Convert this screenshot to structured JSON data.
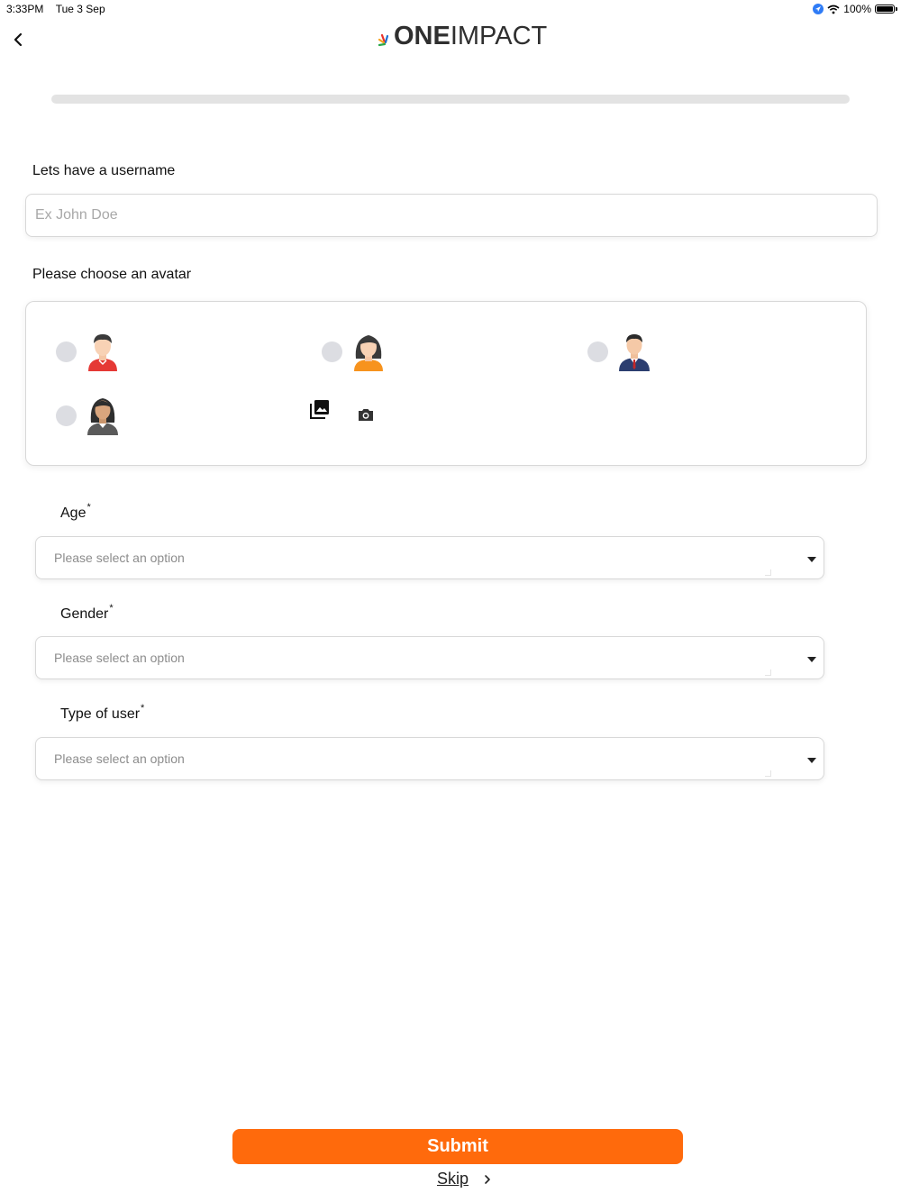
{
  "status_bar": {
    "time": "3:33PM",
    "date": "Tue 3 Sep",
    "battery_percent": "100%",
    "battery_level": 1.0
  },
  "header": {
    "logo_one": "ONE",
    "logo_impact": "IMPACT"
  },
  "progress": {
    "value": 0.0
  },
  "username": {
    "label": "Lets have a username",
    "placeholder": "Ex John Doe",
    "value": ""
  },
  "avatar": {
    "label": "Please choose an avatar",
    "options": [
      {
        "name": "male-avatar-red",
        "selected": false
      },
      {
        "name": "female-avatar-orange",
        "selected": false
      },
      {
        "name": "male-avatar-suit",
        "selected": false
      },
      {
        "name": "female-avatar-grey",
        "selected": false
      }
    ],
    "gallery_icon": "gallery-icon",
    "camera_icon": "camera-icon"
  },
  "fields": {
    "age": {
      "label": "Age",
      "required_mark": "*",
      "placeholder": "Please select an option"
    },
    "gender": {
      "label": "Gender",
      "required_mark": "*",
      "placeholder": "Please select an option"
    },
    "user_type": {
      "label": "Type of user",
      "required_mark": "*",
      "placeholder": "Please select an option"
    }
  },
  "actions": {
    "submit_label": "Submit",
    "skip_label": "Skip"
  },
  "colors": {
    "accent": "#ff6a0c",
    "radio": "#dcdde2",
    "border": "#d8d8d8"
  }
}
